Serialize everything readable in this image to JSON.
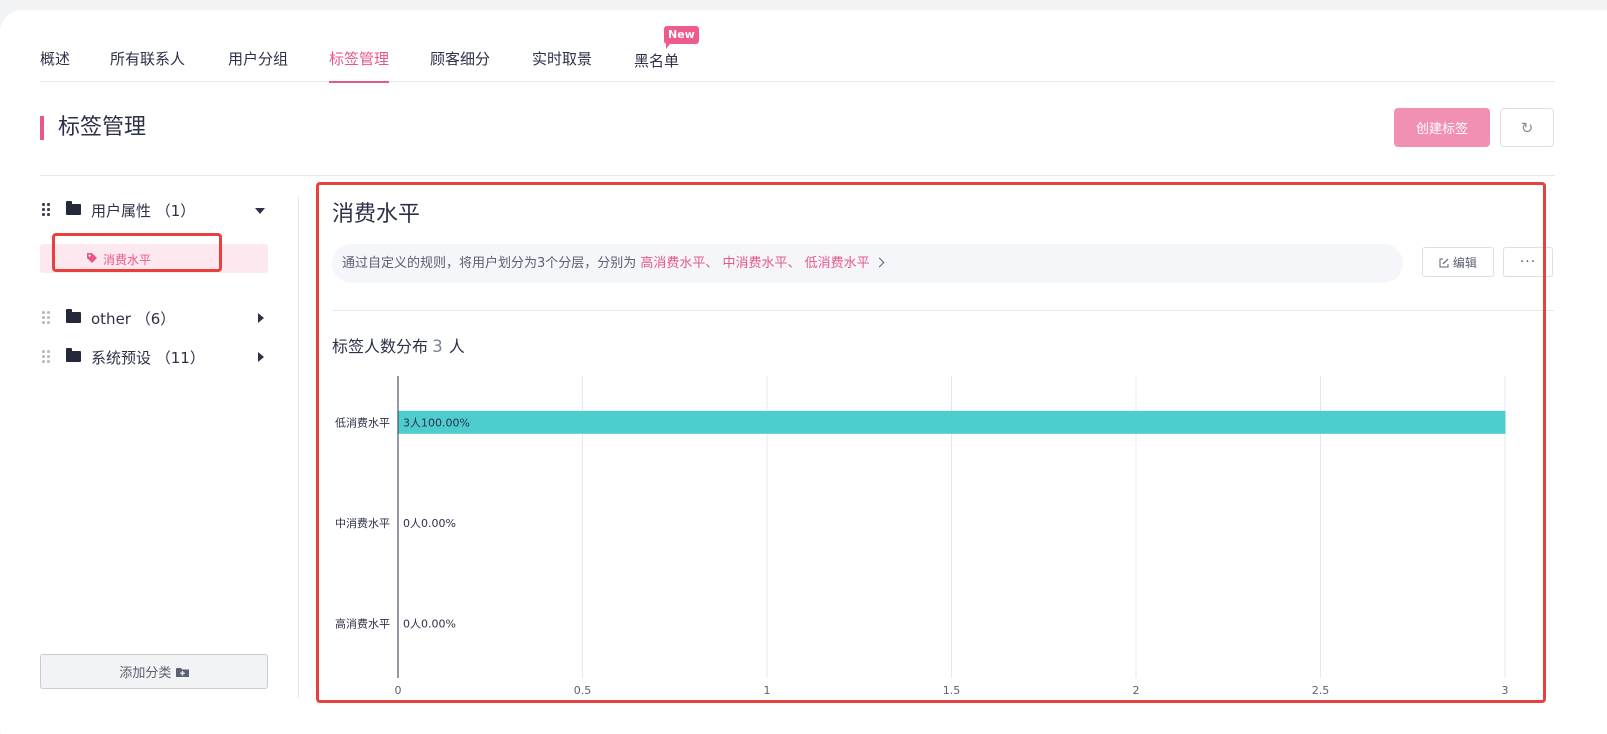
{
  "tabs": [
    {
      "label": "概述",
      "active": false
    },
    {
      "label": "所有联系人",
      "active": false
    },
    {
      "label": "用户分组",
      "active": false
    },
    {
      "label": "标签管理",
      "active": true
    },
    {
      "label": "顾客细分",
      "active": false
    },
    {
      "label": "实时取景",
      "active": false
    },
    {
      "label": "黑名单",
      "active": false,
      "badge": "New"
    }
  ],
  "page_title": "标签管理",
  "actions": {
    "create_label": "创建标签",
    "refresh_icon": "refresh-icon"
  },
  "sidebar": {
    "groups": [
      {
        "label": "用户属性 （1）",
        "expanded": true,
        "items": [
          {
            "label": "消费水平",
            "icon": "tag-icon"
          }
        ]
      },
      {
        "label": "other （6）",
        "expanded": false
      },
      {
        "label": "系统预设 （11）",
        "expanded": false
      }
    ],
    "add_category": "添加分类"
  },
  "detail": {
    "title": "消费水平",
    "description_prefix": "通过自定义的规则，将用户划分为3个分层，分别为 ",
    "description_layers": "高消费水平、 中消费水平、 低消费水平",
    "edit_label": "编辑",
    "more_label": "···",
    "distribution_title": "标签人数分布",
    "distribution_count": "3",
    "distribution_unit": "人"
  },
  "colors": {
    "accent": "#e8578c",
    "bar": "#4ecdcf",
    "highlight_box": "#e8413d"
  },
  "chart_data": {
    "type": "bar",
    "orientation": "horizontal",
    "categories": [
      "低消费水平",
      "中消费水平",
      "高消费水平"
    ],
    "values": [
      3,
      0,
      0
    ],
    "data_labels": [
      "3人100.00%",
      "0人0.00%",
      "0人0.00%"
    ],
    "xlim": [
      0,
      3
    ],
    "xticks": [
      0,
      0.5,
      1,
      1.5,
      2,
      2.5,
      3
    ],
    "xtick_labels": [
      "0",
      "0.5",
      "1",
      "1.5",
      "2",
      "2.5",
      "3"
    ],
    "grid": true
  }
}
